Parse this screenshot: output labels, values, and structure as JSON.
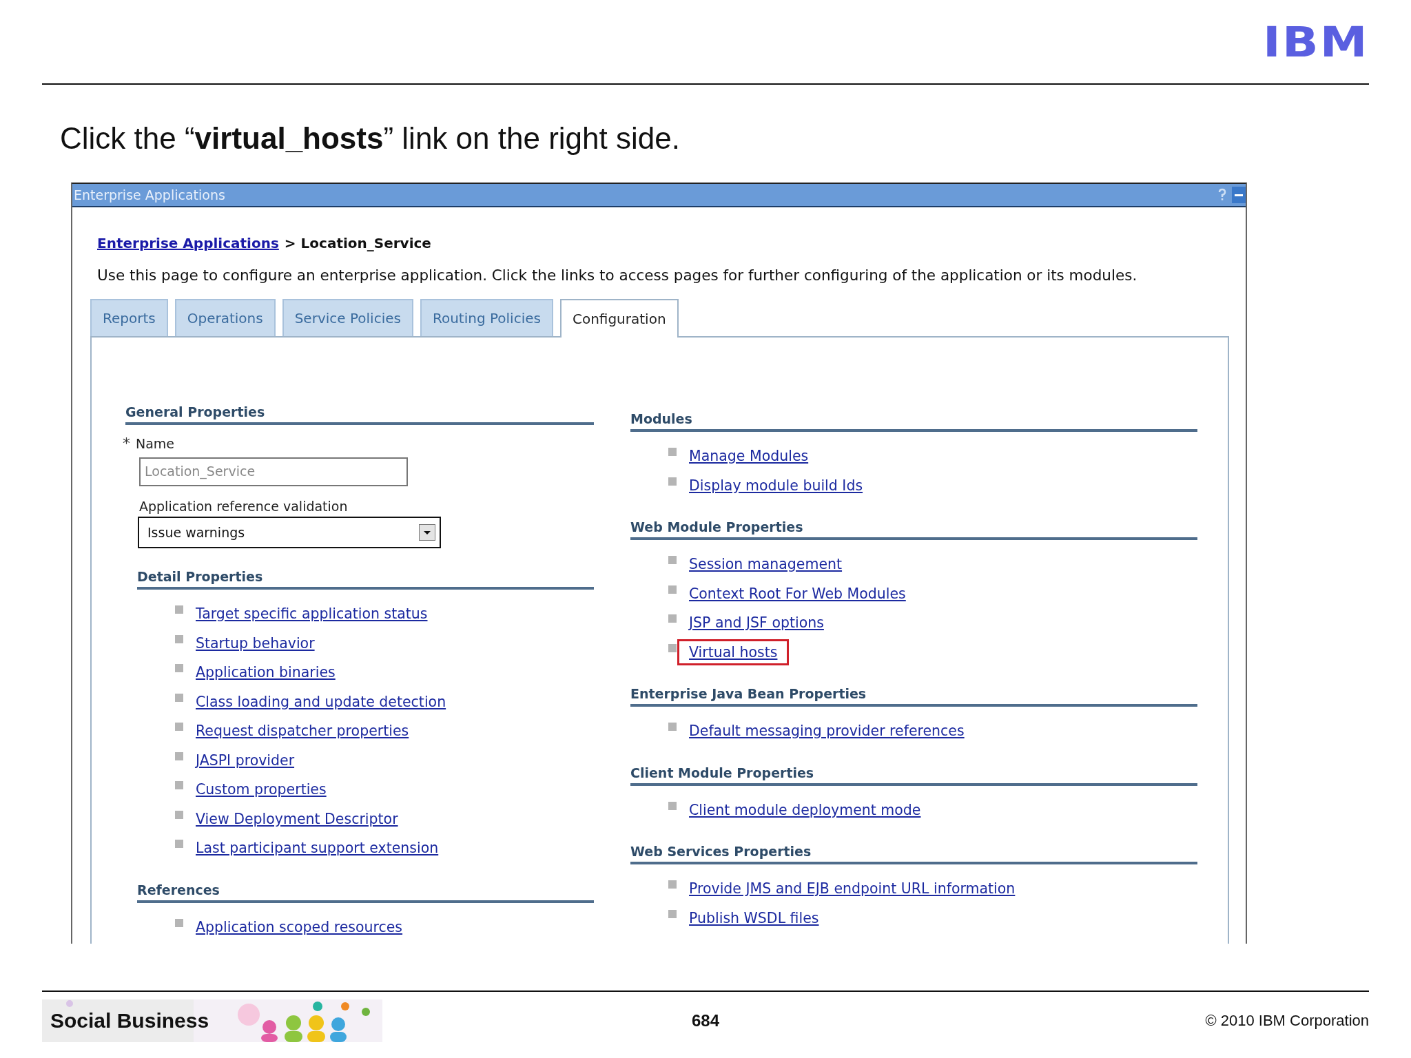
{
  "header": {
    "logo": "IBM"
  },
  "instruction": "Click the “**virtual_hosts**” link on the right side.",
  "window": {
    "title": "Enterprise Applications",
    "breadcrumb": {
      "link": "Enterprise Applications",
      "current": "> Location_Service"
    },
    "description": "Use this page to configure an enterprise application. Click the links to access pages for further configuring of the application or its modules.",
    "tabs": [
      {
        "label": "Reports",
        "selected": false
      },
      {
        "label": "Operations",
        "selected": false
      },
      {
        "label": "Service Policies",
        "selected": false
      },
      {
        "label": "Routing Policies",
        "selected": false
      },
      {
        "label": "Configuration",
        "selected": true
      }
    ],
    "left_sections": [
      {
        "kind": "form",
        "title": "General Properties",
        "required_mark": "*",
        "name_label": "Name",
        "name_value": "Location_Service",
        "select_label": "Application reference validation",
        "select_value": "Issue warnings"
      },
      {
        "kind": "links",
        "title": "Detail Properties",
        "links": [
          {
            "label": "Target specific application status",
            "highlighted": false
          },
          {
            "label": "Startup behavior",
            "highlighted": false
          },
          {
            "label": "Application binaries",
            "highlighted": false
          },
          {
            "label": "Class loading and update detection",
            "highlighted": false
          },
          {
            "label": "Request dispatcher properties",
            "highlighted": false
          },
          {
            "label": "JASPI provider",
            "highlighted": false
          },
          {
            "label": "Custom properties",
            "highlighted": false
          },
          {
            "label": "View Deployment Descriptor",
            "highlighted": false
          },
          {
            "label": "Last participant support extension",
            "highlighted": false
          }
        ]
      },
      {
        "kind": "links",
        "title": "References",
        "links": [
          {
            "label": "Application scoped resources",
            "highlighted": false
          }
        ]
      }
    ],
    "right_sections": [
      {
        "kind": "links",
        "title": "Modules",
        "links": [
          {
            "label": "Manage Modules",
            "highlighted": false
          },
          {
            "label": "Display module build Ids",
            "highlighted": false
          }
        ]
      },
      {
        "kind": "links",
        "title": "Web Module Properties",
        "links": [
          {
            "label": "Session management",
            "highlighted": false
          },
          {
            "label": "Context Root For Web Modules",
            "highlighted": false
          },
          {
            "label": "JSP and JSF options",
            "highlighted": false
          },
          {
            "label": "Virtual hosts",
            "highlighted": true
          }
        ]
      },
      {
        "kind": "links",
        "title": "Enterprise Java Bean Properties",
        "links": [
          {
            "label": "Default messaging provider references",
            "highlighted": false
          }
        ]
      },
      {
        "kind": "links",
        "title": "Client Module Properties",
        "links": [
          {
            "label": "Client module deployment mode",
            "highlighted": false
          }
        ]
      },
      {
        "kind": "links",
        "title": "Web Services Properties",
        "links": [
          {
            "label": "Provide JMS and EJB endpoint URL information",
            "highlighted": false
          },
          {
            "label": "Publish WSDL files",
            "highlighted": false
          }
        ]
      }
    ]
  },
  "footer": {
    "brand": "Social Business",
    "page": "684",
    "copyright": "© 2010 IBM Corporation"
  }
}
